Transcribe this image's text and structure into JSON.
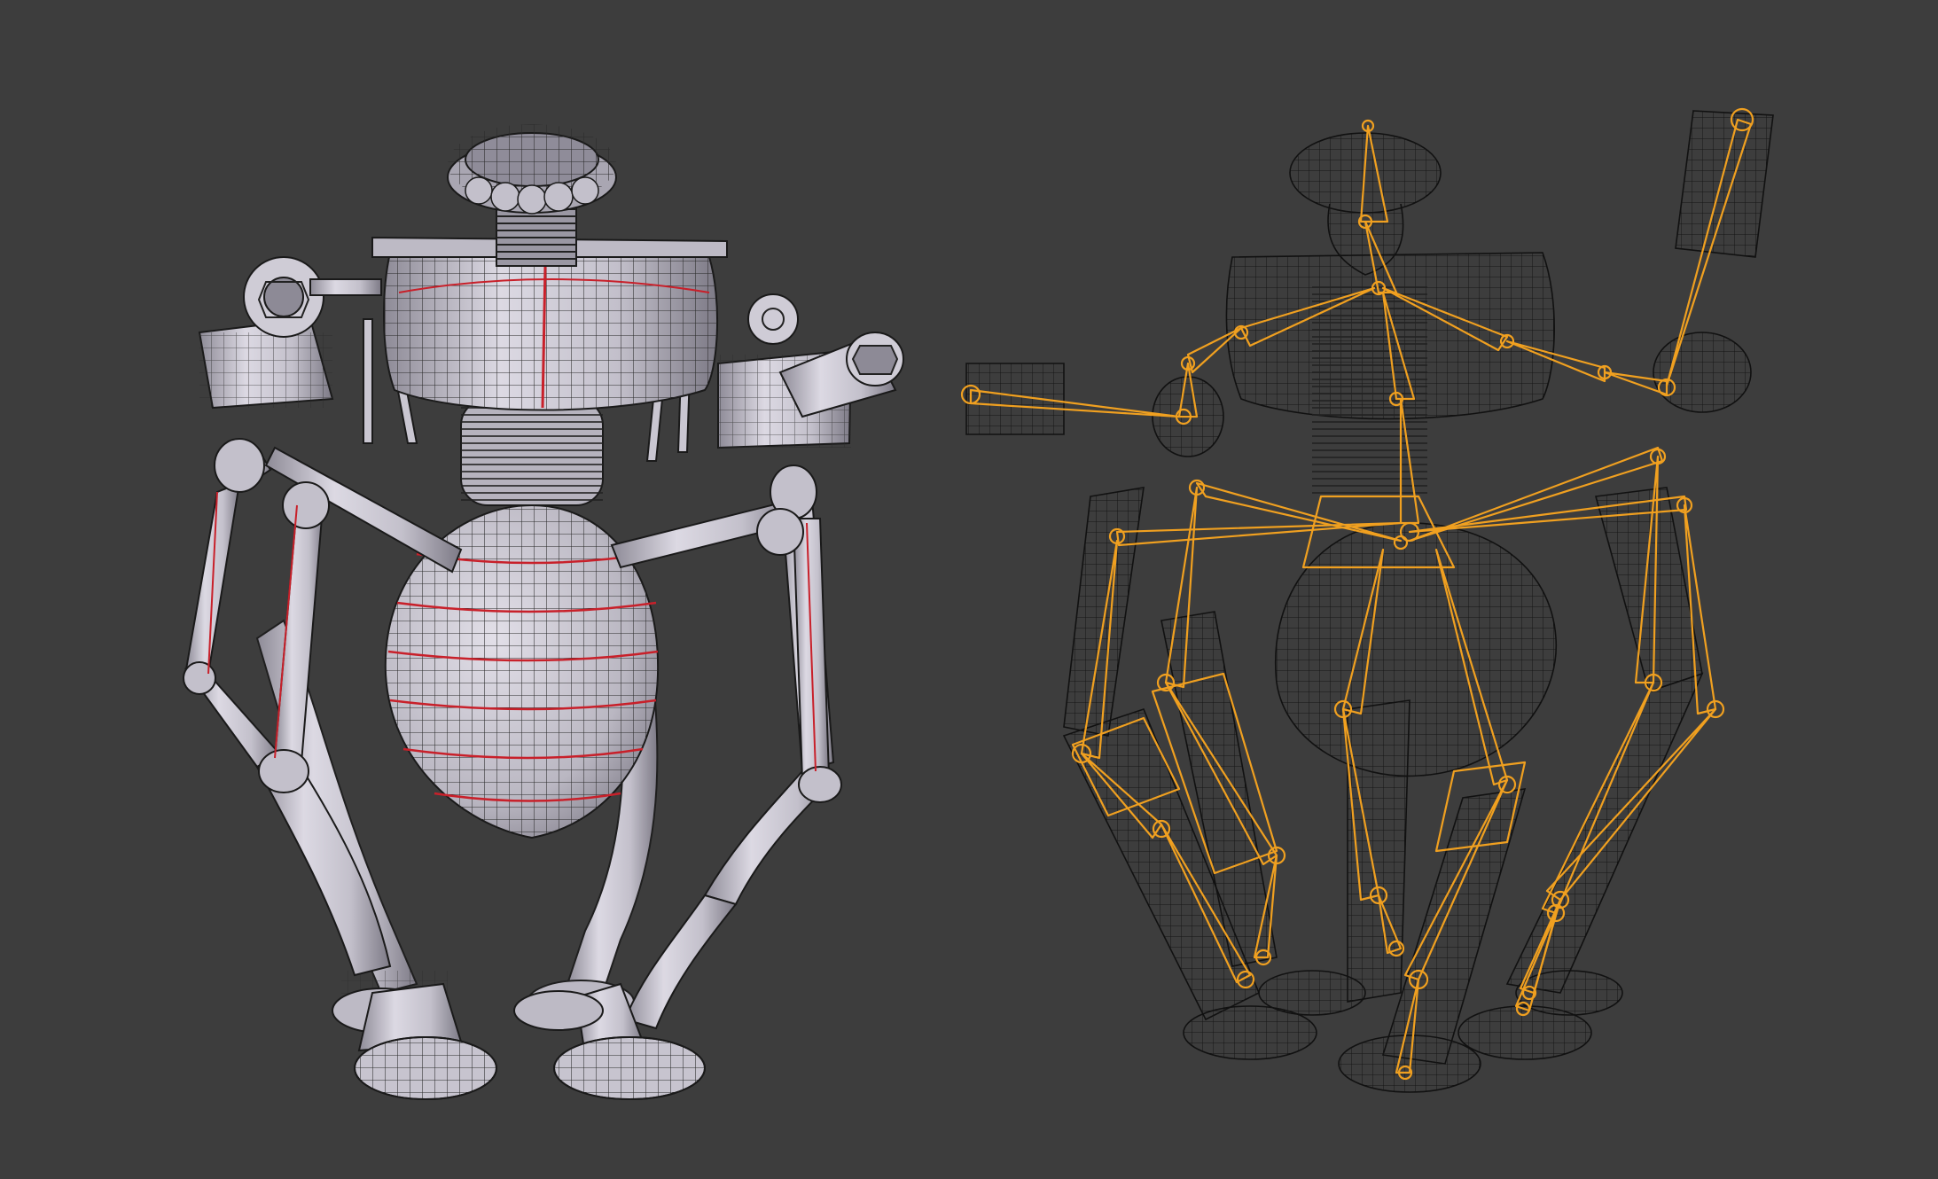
{
  "viewport": {
    "background_color": "#3d3d3d"
  },
  "left_model": {
    "display": "solid-wireframe",
    "surface_color": "#c9c6d1",
    "wire_color": "#1a1a1a",
    "seam_color": "#c8202a"
  },
  "right_model": {
    "display": "wireframe-with-armature",
    "wire_color": "#111111",
    "bone_color": "#f0a020"
  }
}
